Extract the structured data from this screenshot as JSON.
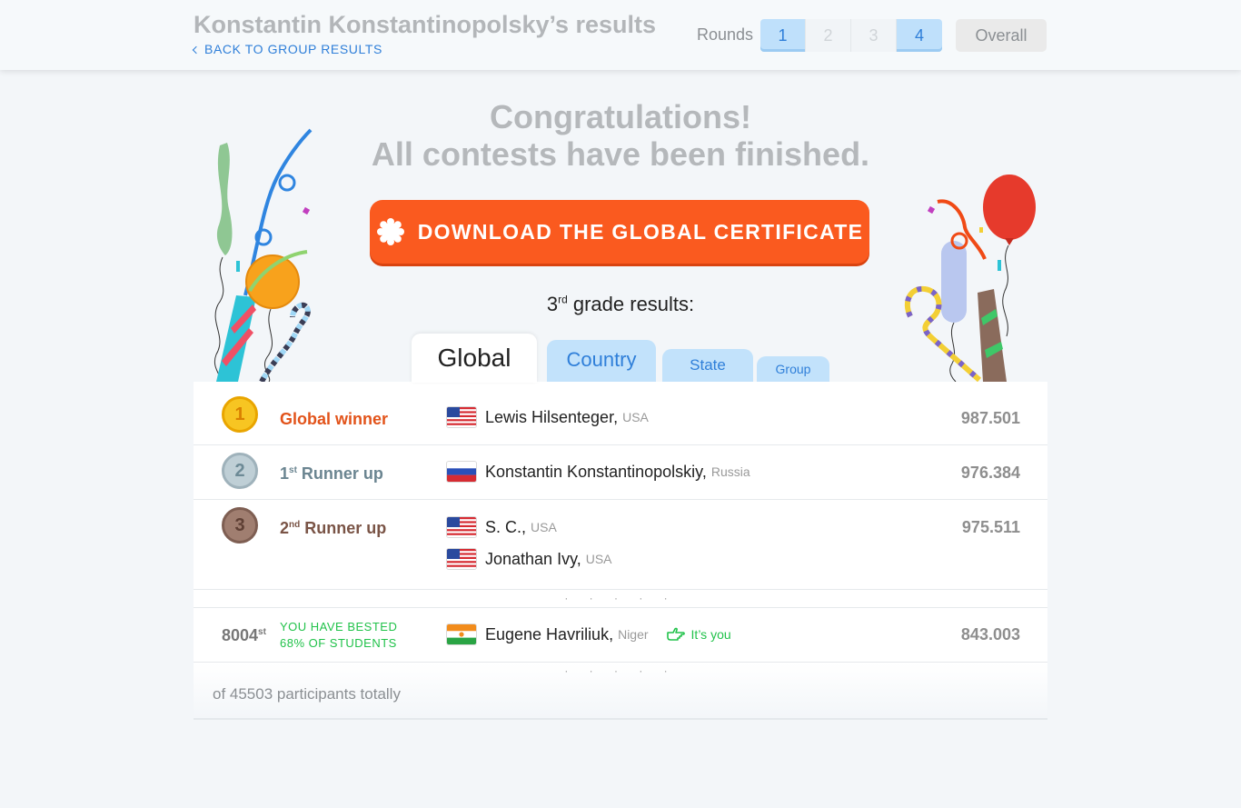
{
  "header": {
    "title": "Konstantin Konstantinopolsky’s results",
    "back_label": "BACK TO GROUP RESULTS",
    "rounds_label": "Rounds",
    "rounds": [
      {
        "label": "1",
        "active": true
      },
      {
        "label": "2",
        "active": false
      },
      {
        "label": "3",
        "active": false
      },
      {
        "label": "4",
        "active": true
      }
    ],
    "overall_label": "Overall"
  },
  "congrats": {
    "line1": "Congratulations!",
    "line2": "All contests have been finished."
  },
  "certificate_button": "DOWNLOAD THE GLOBAL CERTIFICATE",
  "grade": {
    "number": "3",
    "suffix": "rd",
    "text": " grade results:"
  },
  "tabs": {
    "global": "Global",
    "country": "Country",
    "state": "State",
    "group": "Group"
  },
  "results": [
    {
      "medal": "1",
      "place": "Global winner",
      "place_sup": "",
      "people": [
        {
          "name": "Lewis Hilsenteger,",
          "country": "USA",
          "flag": "usa"
        }
      ],
      "score": "987.501"
    },
    {
      "medal": "2",
      "place_pre": "1",
      "place_sup": "st",
      "place": " Runner up",
      "people": [
        {
          "name": "Konstantin Konstantinopolskiy,",
          "country": "Russia",
          "flag": "russia"
        }
      ],
      "score": "976.384"
    },
    {
      "medal": "3",
      "place_pre": "2",
      "place_sup": "nd",
      "place": " Runner up",
      "people": [
        {
          "name": "S. C.,",
          "country": "USA",
          "flag": "usa"
        },
        {
          "name": "Jonathan Ivy,",
          "country": "USA",
          "flag": "usa"
        }
      ],
      "score": "975.511"
    }
  ],
  "separator": "· · · · ·",
  "me": {
    "rank": "8004",
    "rank_sup": "st",
    "besting_line1": "YOU HAVE BESTED",
    "besting_line2": "68% OF STUDENTS",
    "name": "Eugene Havriliuk,",
    "country": "Niger",
    "flag": "niger",
    "its_you": "It’s you",
    "score": "843.003"
  },
  "total_text": "of 45503 participants totally",
  "colors": {
    "accent": "#fa5a1f",
    "link": "#2f7fd9",
    "tab": "#c2e2fb",
    "success": "#21c24a",
    "gold": "#f7c522",
    "silver": "#bfcfd6",
    "bronze": "#a07e70"
  }
}
